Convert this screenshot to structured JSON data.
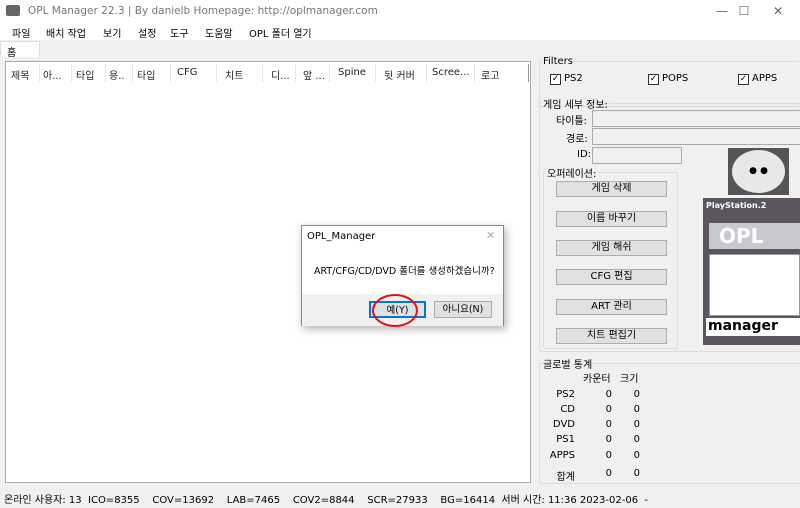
{
  "window": {
    "title": "OPL Manager 22.3 | By danielb Homepage: http://oplmanager.com",
    "minimize": "—",
    "maximize": "☐",
    "close": "✕"
  },
  "menu": [
    "파일",
    "배치 작업",
    "보기",
    "설정",
    "도구",
    "도움말",
    "OPL 폴더 열기"
  ],
  "tabs": [
    "홈"
  ],
  "columns": [
    "제목",
    "아...",
    "타입",
    "용..",
    "타입",
    "CFG",
    "치트",
    "디...",
    "앞 ...",
    "Spine",
    "뒷 커버",
    "Scree...",
    "로고"
  ],
  "filters": {
    "title": "Filters",
    "items": [
      {
        "label": "PS2",
        "checked": true
      },
      {
        "label": "POPS",
        "checked": true
      },
      {
        "label": "APPS",
        "checked": true
      }
    ]
  },
  "details": {
    "title": "게임 세부 정보:",
    "title_label": "타이틀:",
    "path_label": "경로:",
    "id_label": "ID:",
    "title_value": "",
    "path_value": "",
    "id_value": ""
  },
  "operations": {
    "title": "오퍼레이션:",
    "buttons": [
      "게임 삭제",
      "이름 바꾸기",
      "게임 해쉬",
      "CFG 편집",
      "ART 관리",
      "치트 편집기"
    ]
  },
  "images": {
    "disc_text": "OPL manager",
    "cover_header": "PlayStation.2",
    "cover_logo": "OPL",
    "cover_footer": "manager"
  },
  "stats": {
    "title": "글로벌 통계",
    "headers": [
      "카운터",
      "크기"
    ],
    "rows": [
      {
        "label": "PS2",
        "count": "0",
        "size": "0"
      },
      {
        "label": "CD",
        "count": "0",
        "size": "0"
      },
      {
        "label": "DVD",
        "count": "0",
        "size": "0"
      },
      {
        "label": "PS1",
        "count": "0",
        "size": "0"
      },
      {
        "label": "APPS",
        "count": "0",
        "size": "0"
      },
      {
        "label": "합계",
        "count": "0",
        "size": "0"
      }
    ]
  },
  "status": "온라인 사용자: 13  ICO=8355    COV=13692    LAB=7465    COV2=8844    SCR=27933    BG=16414  서버 시간: 11:36 2023-02-06  -",
  "dialog": {
    "title": "OPL_Manager",
    "message": "ART/CFG/CD/DVD 폴더를 생성하겠습니까?",
    "yes": "예(Y)",
    "no": "아니요(N)",
    "close": "✕"
  },
  "colors": {
    "highlight": "#e0101a",
    "accent": "#0078d7"
  }
}
